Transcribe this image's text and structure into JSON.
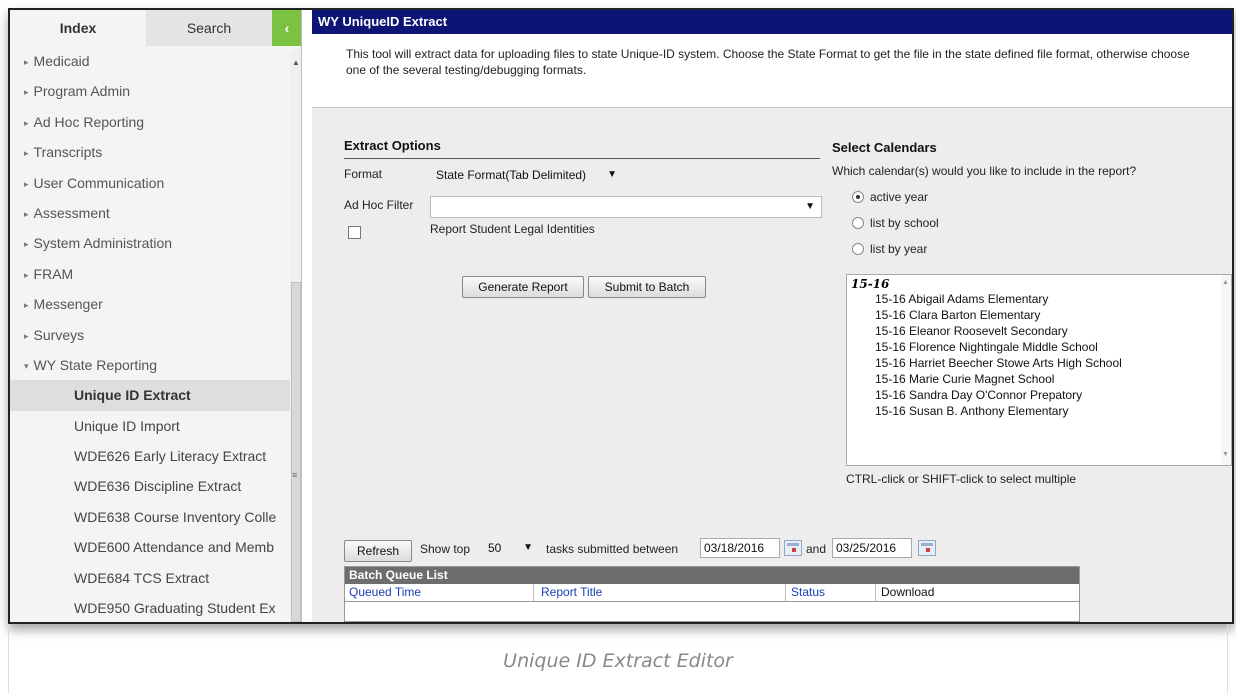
{
  "sidebar": {
    "tabs": {
      "index": "Index",
      "search": "Search",
      "collapse": "‹"
    },
    "items": [
      {
        "label": "Medicaid",
        "arrow": "▸"
      },
      {
        "label": "Program Admin",
        "arrow": "▸"
      },
      {
        "label": "Ad Hoc Reporting",
        "arrow": "▸"
      },
      {
        "label": "Transcripts",
        "arrow": "▸"
      },
      {
        "label": "User Communication",
        "arrow": "▸"
      },
      {
        "label": "Assessment",
        "arrow": "▸"
      },
      {
        "label": "System Administration",
        "arrow": "▸"
      },
      {
        "label": "FRAM",
        "arrow": "▸"
      },
      {
        "label": "Messenger",
        "arrow": "▸"
      },
      {
        "label": "Surveys",
        "arrow": "▸"
      },
      {
        "label": "WY State Reporting",
        "arrow": "▾"
      }
    ],
    "subitems": [
      {
        "label": "Unique ID Extract"
      },
      {
        "label": "Unique ID Import"
      },
      {
        "label": "WDE626 Early Literacy Extract"
      },
      {
        "label": "WDE636 Discipline Extract"
      },
      {
        "label": "WDE638 Course Inventory Colle"
      },
      {
        "label": "WDE600 Attendance and Memb"
      },
      {
        "label": "WDE684 TCS Extract"
      },
      {
        "label": "WDE950 Graduating Student Ex"
      }
    ]
  },
  "main": {
    "title": "WY UniqueID Extract",
    "description": "This tool will extract data for uploading files to state Unique-ID system. Choose the State Format to get the file in the state defined file format, otherwise choose one of the several testing/debugging formats.",
    "extract_options": {
      "heading": "Extract Options",
      "format_label": "Format",
      "format_value": "State Format(Tab Delimited)",
      "adhoc_label": "Ad Hoc Filter",
      "adhoc_value": "",
      "legal_identities_label": "Report Student Legal Identities",
      "generate_button": "Generate Report",
      "batch_button": "Submit to Batch"
    },
    "select_calendars": {
      "heading": "Select Calendars",
      "question": "Which calendar(s) would you like to include in the report?",
      "radio_active": "active year",
      "radio_school": "list by school",
      "radio_year": "list by year",
      "group": "15-16",
      "calendars": [
        "15-16 Abigail Adams Elementary",
        "15-16 Clara Barton Elementary",
        "15-16 Eleanor Roosevelt Secondary",
        "15-16 Florence Nightingale Middle School",
        "15-16 Harriet Beecher Stowe Arts High School",
        "15-16 Marie Curie Magnet School",
        "15-16 Sandra Day O'Connor Prepatory",
        "15-16 Susan B. Anthony Elementary"
      ],
      "hint": "CTRL-click or SHIFT-click to select multiple"
    },
    "batch": {
      "refresh_button": "Refresh",
      "show_top_label": "Show top",
      "show_top_value": "50",
      "tasks_label": "tasks submitted between",
      "start_date": "03/18/2016",
      "and_label": "and",
      "end_date": "03/25/2016",
      "list_title": "Batch Queue List",
      "columns": [
        "Queued Time",
        "Report Title",
        "Status",
        "Download"
      ]
    }
  },
  "caption": "Unique ID Extract Editor"
}
